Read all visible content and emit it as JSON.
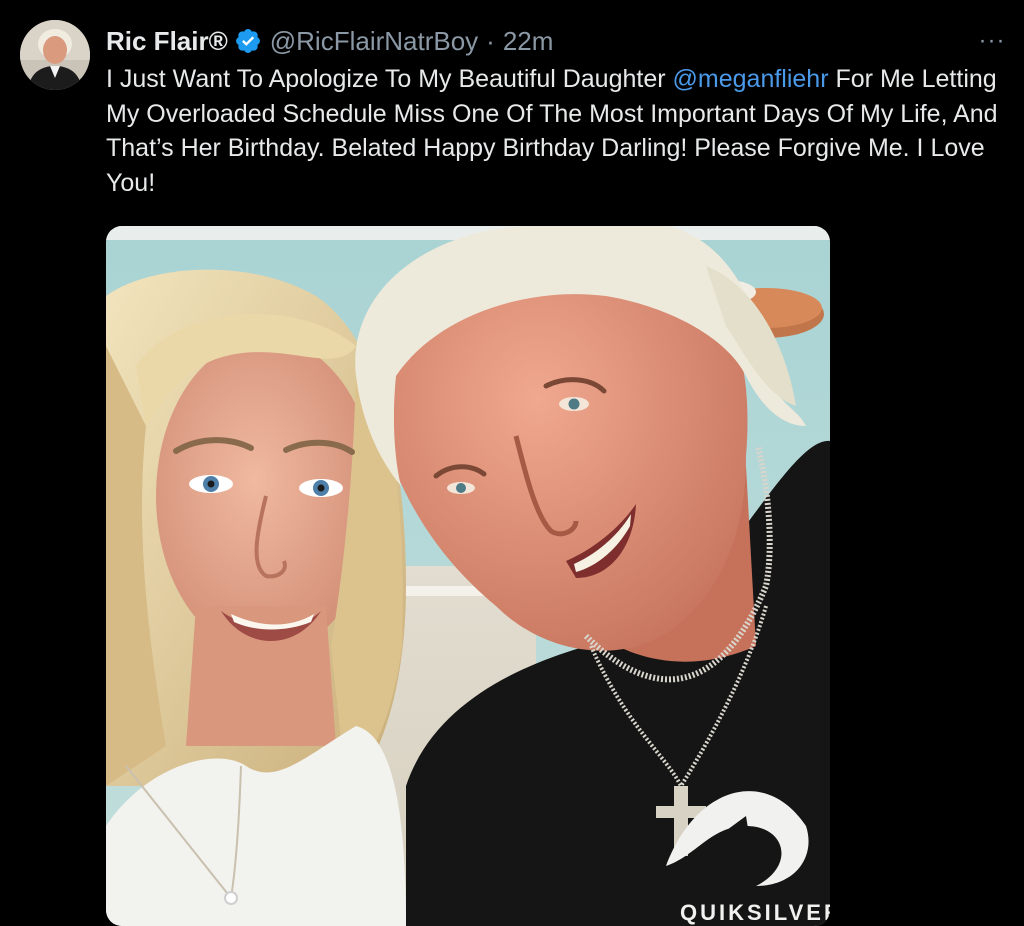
{
  "tweet": {
    "display_name": "Ric Flair®",
    "handle": "@RicFlairNatrBoy",
    "separator": "·",
    "time": "22m",
    "more_label": "···",
    "text_before": "I Just Want To Apologize To My Beautiful Daughter ",
    "mention": "@meganfliehr",
    "text_after": " For Me Letting My Overloaded Schedule Miss One Of The Most Important Days Of My Life, And That’s Her Birthday. Belated Happy Birthday Darling! Please Forgive Me. I Love You!",
    "shirt_logo_text": "QUIKSILVER"
  },
  "colors": {
    "background": "#000000",
    "text": "#e7e9ea",
    "secondary": "#8b98a5",
    "link": "#4b99e9",
    "verified": "#1d9bf0"
  },
  "icons": {
    "verified": "verified-badge-icon",
    "more": "more-horizontal-icon"
  }
}
